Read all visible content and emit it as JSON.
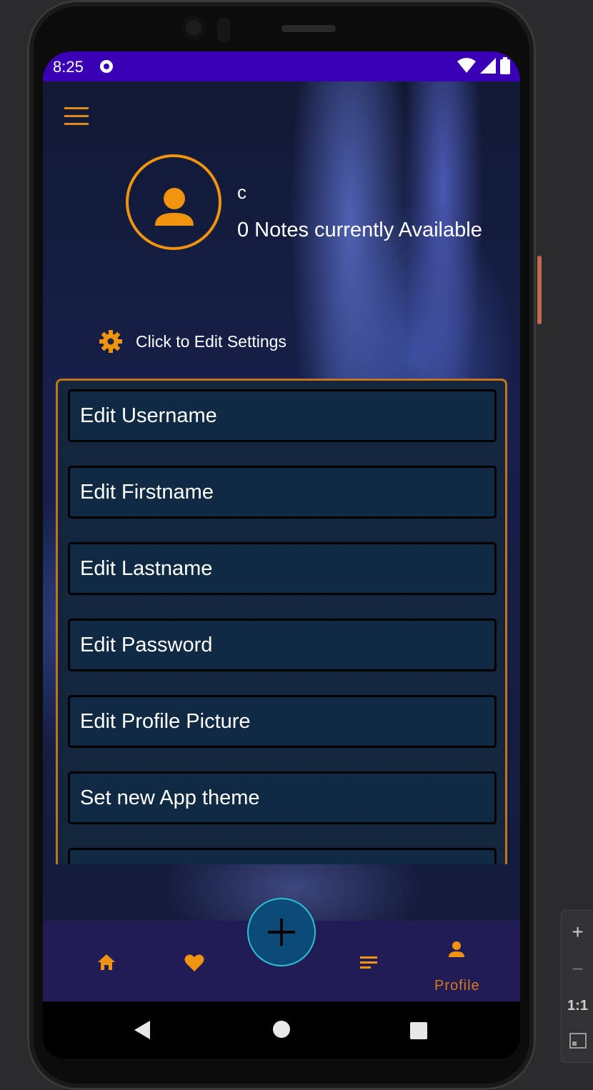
{
  "status_bar": {
    "time": "8:25",
    "notification_icon": "dot-icon",
    "icons": [
      "wifi-icon",
      "signal-icon",
      "battery-icon"
    ]
  },
  "header": {
    "menu_icon": "hamburger-menu-icon"
  },
  "profile": {
    "avatar_icon": "person-icon",
    "username": "c",
    "notes_text": "0 Notes currently Available"
  },
  "settings": {
    "icon": "gear-icon",
    "label": "Click to Edit Settings"
  },
  "edit_options": [
    {
      "label": "Edit Username"
    },
    {
      "label": "Edit Firstname"
    },
    {
      "label": "Edit Lastname"
    },
    {
      "label": "Edit Password"
    },
    {
      "label": "Edit Profile Picture"
    },
    {
      "label": "Set new App theme"
    }
  ],
  "bottom_nav": {
    "items": [
      {
        "icon": "home-icon"
      },
      {
        "icon": "heart-icon"
      },
      {
        "icon": "notes-list-icon"
      },
      {
        "icon": "person-icon",
        "label": "Profile",
        "active": true
      }
    ],
    "fab_icon": "plus-icon"
  },
  "system_nav": {
    "icons": [
      "back-icon",
      "home-circle-icon",
      "recents-icon"
    ]
  },
  "zoom_controls": {
    "plus": "+",
    "minus": "−",
    "ratio": "1:1"
  },
  "colors": {
    "accent": "#f0930f",
    "status_bar": "#3a00b6",
    "nav_bar": "#211c55",
    "panel": "#13263d",
    "fab": "#0b4a78"
  }
}
